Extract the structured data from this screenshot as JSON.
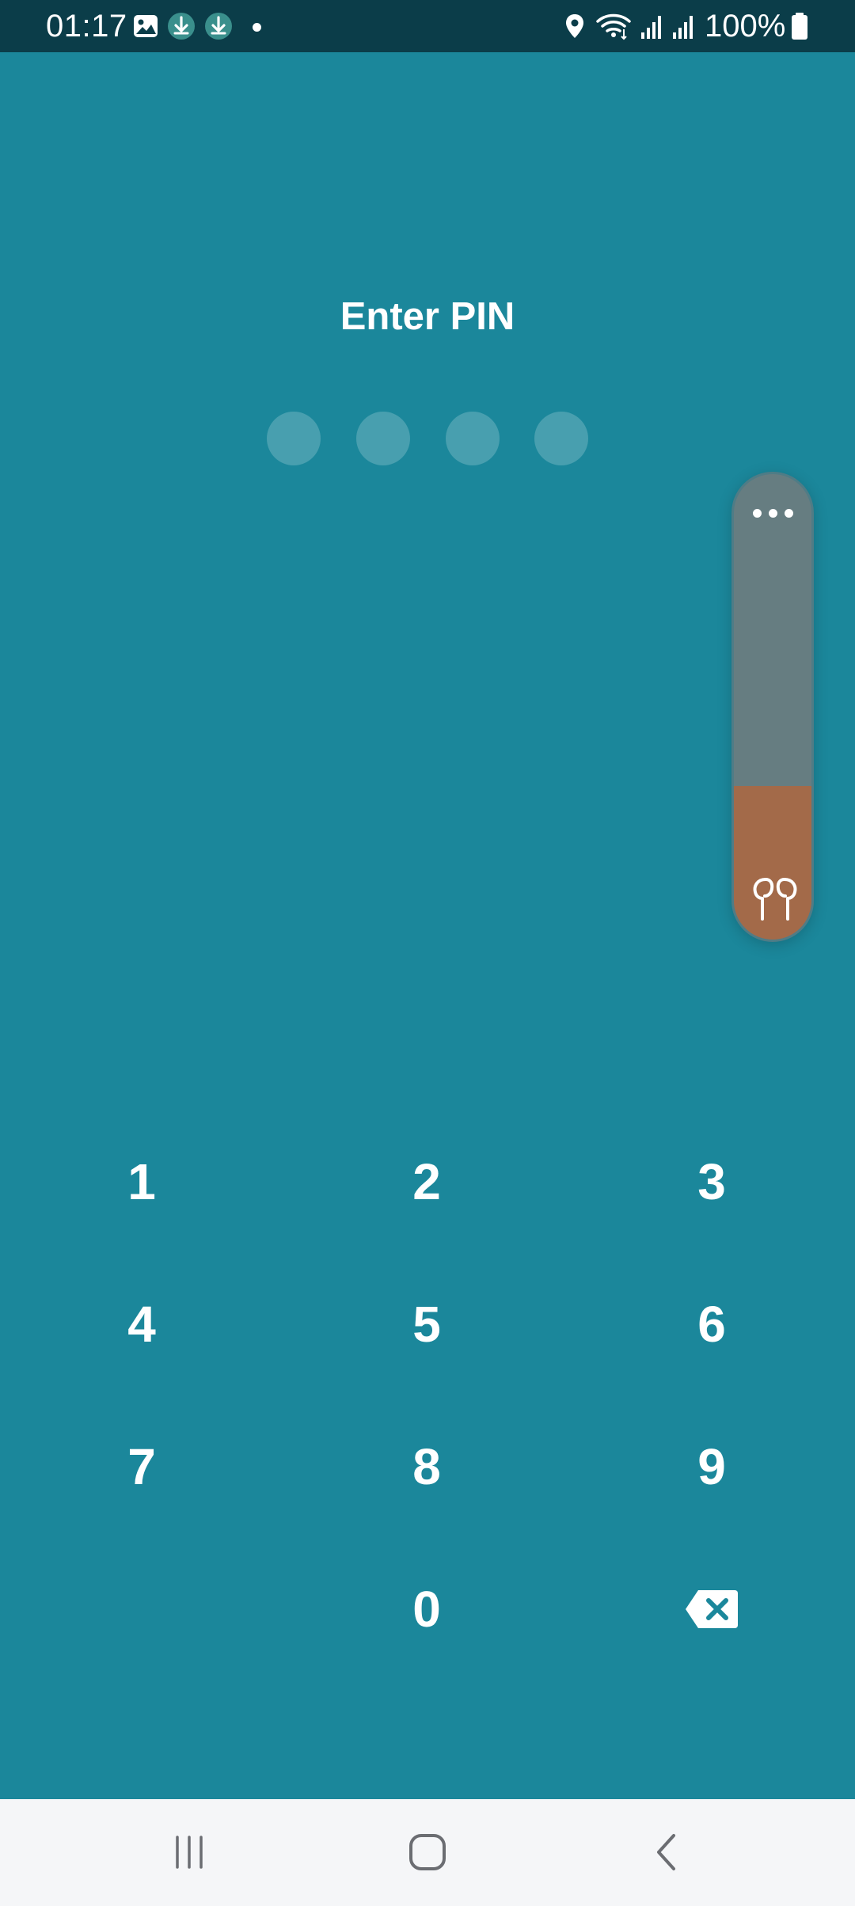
{
  "status_bar": {
    "time": "01:17",
    "battery_text": "100%",
    "icons": [
      "gallery-notification-icon",
      "download-app-icon",
      "download-app-icon",
      "notification-dot-icon",
      "location-icon",
      "wifi-icon",
      "signal-icon",
      "signal-icon",
      "battery-icon"
    ]
  },
  "pin_screen": {
    "title": "Enter PIN",
    "dot_count": 4,
    "entered_digits": 0
  },
  "volume_panel": {
    "more_icon": "more-dots-icon",
    "device_icon": "earbuds-icon",
    "level_fraction": 0.33
  },
  "keypad": {
    "keys": [
      {
        "label": "1"
      },
      {
        "label": "2"
      },
      {
        "label": "3"
      },
      {
        "label": "4"
      },
      {
        "label": "5"
      },
      {
        "label": "6"
      },
      {
        "label": "7"
      },
      {
        "label": "8"
      },
      {
        "label": "9"
      },
      {
        "label": ""
      },
      {
        "label": "0"
      },
      {
        "label": "",
        "icon": "backspace-icon"
      }
    ]
  },
  "nav_bar": {
    "recents_icon": "recents-icon",
    "home_icon": "home-icon",
    "back_icon": "back-icon"
  },
  "colors": {
    "background": "#1b879b",
    "status_bar": "#0b3d49",
    "volume_track": "#667d81",
    "volume_fill": "#a36a49",
    "nav_bar": "#f5f6f8"
  }
}
